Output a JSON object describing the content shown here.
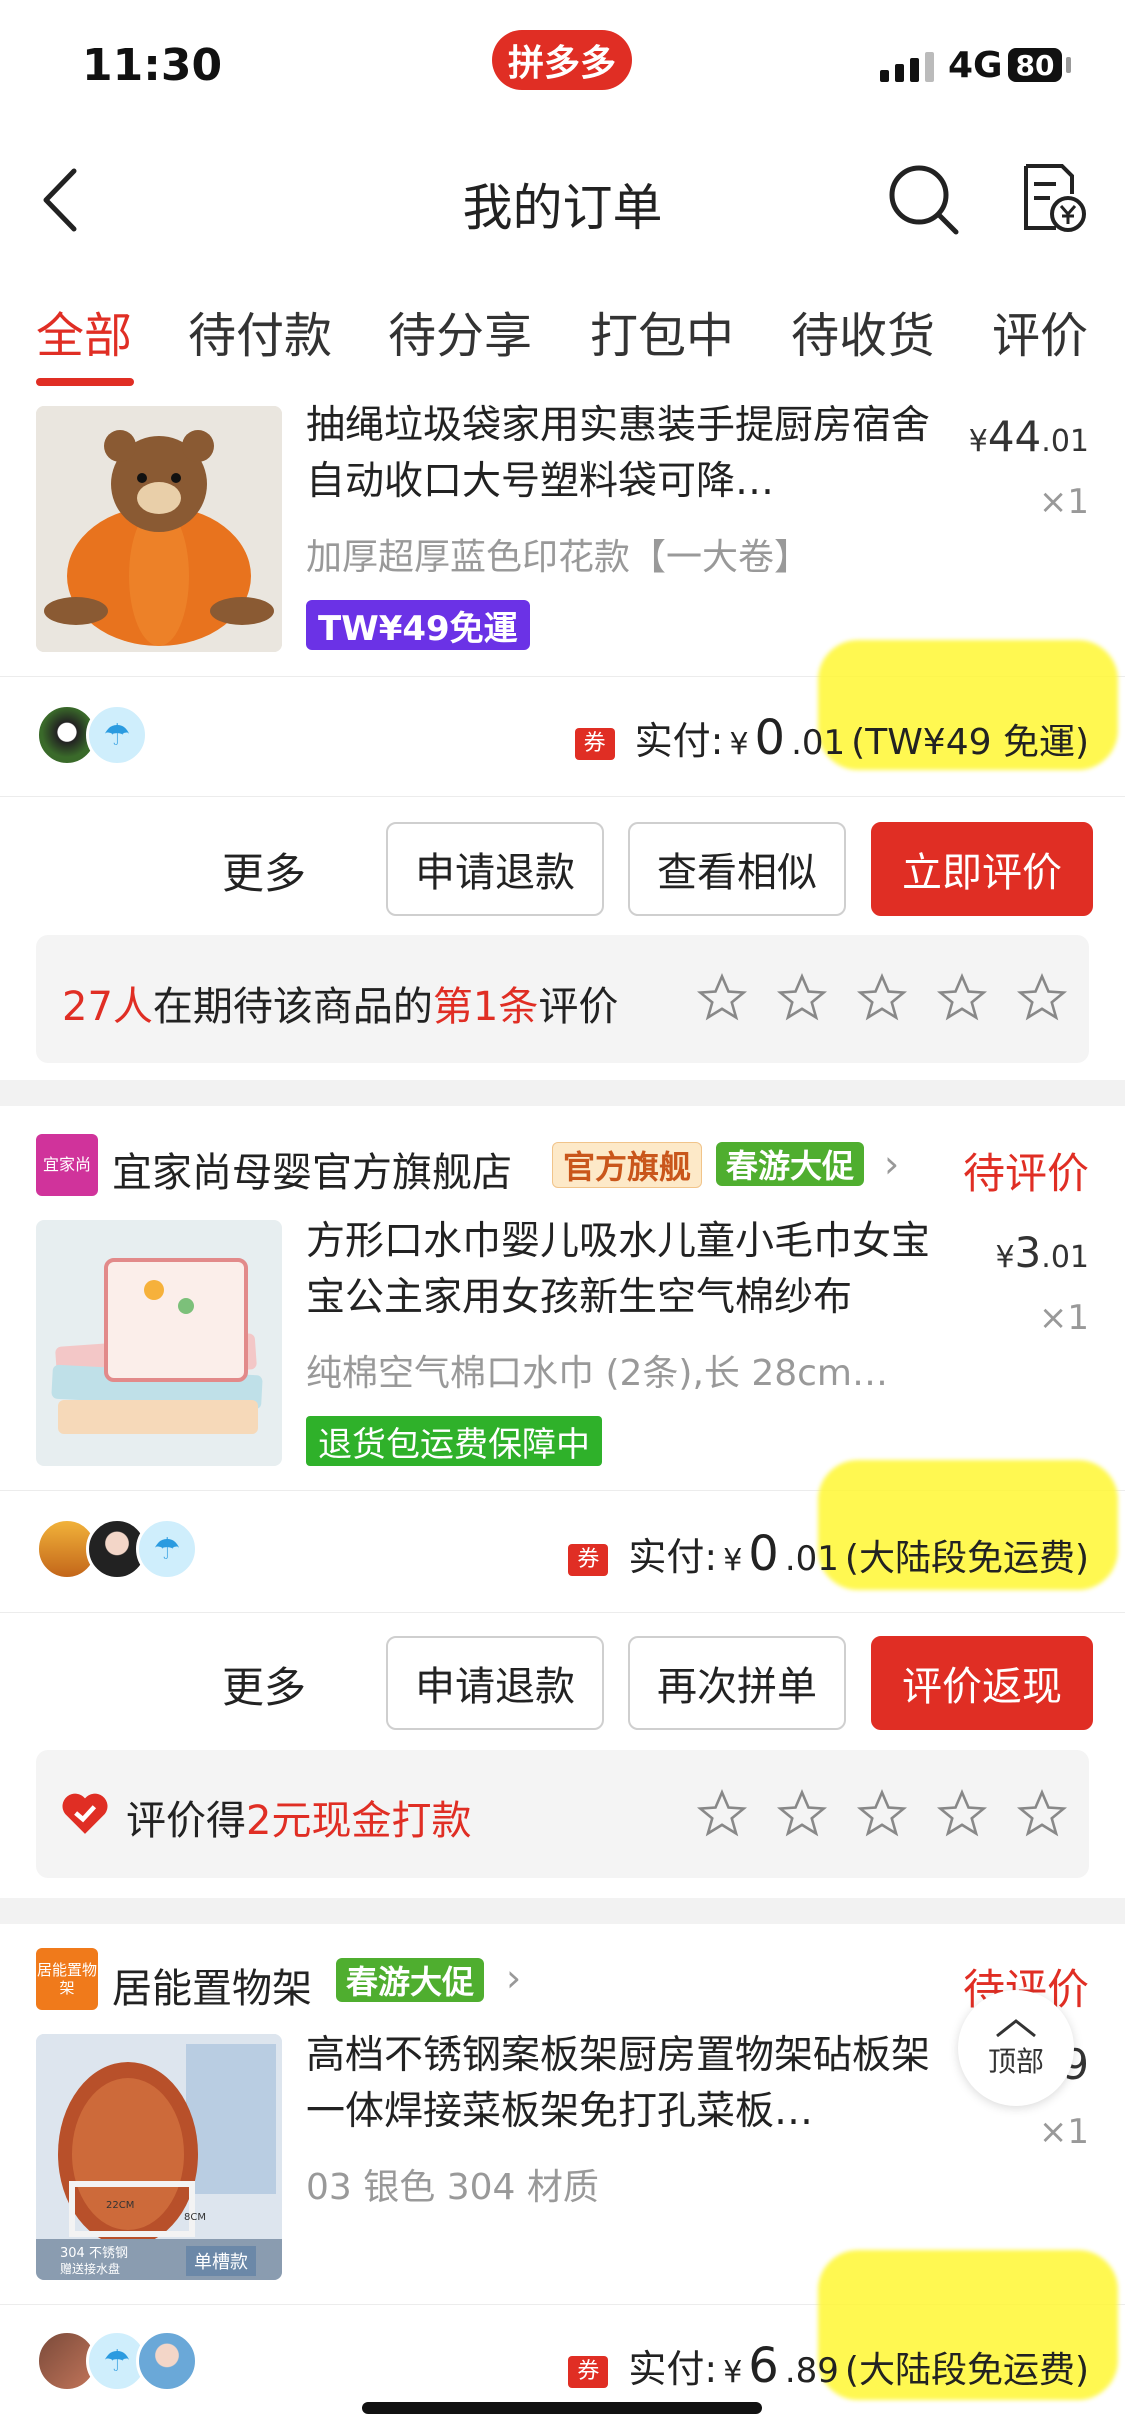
{
  "status_bar": {
    "time": "11:30",
    "app_badge": "拼多多",
    "network": "4G",
    "battery": "80"
  },
  "header": {
    "title": "我的订单"
  },
  "tabs": [
    {
      "label": "全部",
      "active": true
    },
    {
      "label": "待付款"
    },
    {
      "label": "待分享"
    },
    {
      "label": "打包中"
    },
    {
      "label": "待收货"
    },
    {
      "label": "评价"
    }
  ],
  "orders": [
    {
      "title": "抽绳垃圾袋家用实惠装手提厨房宿舍自动收口大号塑料袋可降…",
      "sku": "加厚超厚蓝色印花款【一大卷】",
      "price_symbol": "¥",
      "price_int": "44",
      "price_dec": ".01",
      "qty": "×1",
      "tag": "TW¥49免運",
      "paid_label": "实付:",
      "paid_symbol": "¥",
      "paid_int": "0",
      "paid_dec": ".01",
      "paid_note": "(TW¥49 免運)",
      "coupon": "券",
      "buttons": {
        "more": "更多",
        "b1": "申请退款",
        "b2": "查看相似",
        "b3": "立即评价"
      },
      "review": {
        "count": "27人",
        "mid": "在期待该商品的",
        "nth": "第1条",
        "end": "评价"
      }
    },
    {
      "shop_logo": "宜家尚",
      "shop_name": "宜家尚母婴官方旗舰店",
      "badge1": "官方旗舰",
      "badge2": "春游大促",
      "status": "待评价",
      "title": "方形口水巾婴儿吸水儿童小毛巾女宝宝公主家用女孩新生空气棉纱布",
      "sku": "纯棉空气棉口水巾 (2条),长 28cm…",
      "price_symbol": "¥",
      "price_int": "3",
      "price_dec": ".01",
      "qty": "×1",
      "tag": "退货包运费保障中",
      "paid_label": "实付:",
      "paid_symbol": "¥",
      "paid_int": "0",
      "paid_dec": ".01",
      "paid_note": "(大陆段免运费)",
      "coupon": "券",
      "buttons": {
        "more": "更多",
        "b1": "申请退款",
        "b2": "再次拼单",
        "b3": "评价返现"
      },
      "review": {
        "pre": "评价得",
        "amount": "2元现金打款"
      }
    },
    {
      "shop_logo": "居能置物架",
      "shop_name": "居能置物架",
      "badge2": "春游大促",
      "status": "待评价",
      "title": "高档不锈钢案板架厨房置物架砧板架一体焊接菜板架免打孔菜板…",
      "sku": "03 银色 304 材质",
      "price_partial": "9",
      "qty": "×1",
      "paid_label": "实付:",
      "paid_symbol": "¥",
      "paid_int": "6",
      "paid_dec": ".89",
      "paid_note": "(大陆段免运费)",
      "coupon": "券",
      "thumb_caption": "304 不锈钢",
      "thumb_caption2": "赠送接水盘",
      "thumb_badge": "单槽款",
      "thumb_dim1": "22CM",
      "thumb_dim2": "8CM"
    }
  ],
  "to_top": "顶部",
  "colors": {
    "accent": "#e02e24",
    "highlight": "#fff733"
  }
}
